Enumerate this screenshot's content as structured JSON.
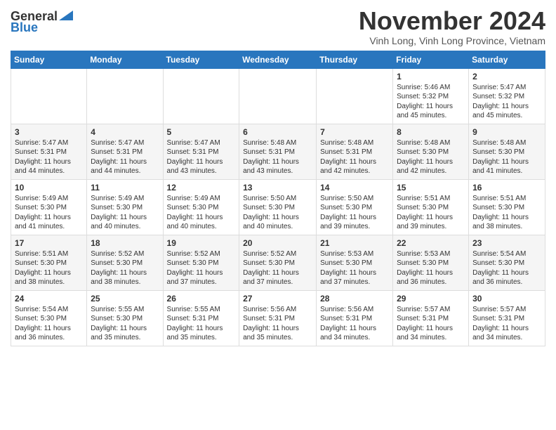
{
  "header": {
    "logo_general": "General",
    "logo_blue": "Blue",
    "month_title": "November 2024",
    "location": "Vinh Long, Vinh Long Province, Vietnam"
  },
  "days_of_week": [
    "Sunday",
    "Monday",
    "Tuesday",
    "Wednesday",
    "Thursday",
    "Friday",
    "Saturday"
  ],
  "weeks": [
    [
      {
        "day": "",
        "info": ""
      },
      {
        "day": "",
        "info": ""
      },
      {
        "day": "",
        "info": ""
      },
      {
        "day": "",
        "info": ""
      },
      {
        "day": "",
        "info": ""
      },
      {
        "day": "1",
        "info": "Sunrise: 5:46 AM\nSunset: 5:32 PM\nDaylight: 11 hours and 45 minutes."
      },
      {
        "day": "2",
        "info": "Sunrise: 5:47 AM\nSunset: 5:32 PM\nDaylight: 11 hours and 45 minutes."
      }
    ],
    [
      {
        "day": "3",
        "info": "Sunrise: 5:47 AM\nSunset: 5:31 PM\nDaylight: 11 hours and 44 minutes."
      },
      {
        "day": "4",
        "info": "Sunrise: 5:47 AM\nSunset: 5:31 PM\nDaylight: 11 hours and 44 minutes."
      },
      {
        "day": "5",
        "info": "Sunrise: 5:47 AM\nSunset: 5:31 PM\nDaylight: 11 hours and 43 minutes."
      },
      {
        "day": "6",
        "info": "Sunrise: 5:48 AM\nSunset: 5:31 PM\nDaylight: 11 hours and 43 minutes."
      },
      {
        "day": "7",
        "info": "Sunrise: 5:48 AM\nSunset: 5:31 PM\nDaylight: 11 hours and 42 minutes."
      },
      {
        "day": "8",
        "info": "Sunrise: 5:48 AM\nSunset: 5:30 PM\nDaylight: 11 hours and 42 minutes."
      },
      {
        "day": "9",
        "info": "Sunrise: 5:48 AM\nSunset: 5:30 PM\nDaylight: 11 hours and 41 minutes."
      }
    ],
    [
      {
        "day": "10",
        "info": "Sunrise: 5:49 AM\nSunset: 5:30 PM\nDaylight: 11 hours and 41 minutes."
      },
      {
        "day": "11",
        "info": "Sunrise: 5:49 AM\nSunset: 5:30 PM\nDaylight: 11 hours and 40 minutes."
      },
      {
        "day": "12",
        "info": "Sunrise: 5:49 AM\nSunset: 5:30 PM\nDaylight: 11 hours and 40 minutes."
      },
      {
        "day": "13",
        "info": "Sunrise: 5:50 AM\nSunset: 5:30 PM\nDaylight: 11 hours and 40 minutes."
      },
      {
        "day": "14",
        "info": "Sunrise: 5:50 AM\nSunset: 5:30 PM\nDaylight: 11 hours and 39 minutes."
      },
      {
        "day": "15",
        "info": "Sunrise: 5:51 AM\nSunset: 5:30 PM\nDaylight: 11 hours and 39 minutes."
      },
      {
        "day": "16",
        "info": "Sunrise: 5:51 AM\nSunset: 5:30 PM\nDaylight: 11 hours and 38 minutes."
      }
    ],
    [
      {
        "day": "17",
        "info": "Sunrise: 5:51 AM\nSunset: 5:30 PM\nDaylight: 11 hours and 38 minutes."
      },
      {
        "day": "18",
        "info": "Sunrise: 5:52 AM\nSunset: 5:30 PM\nDaylight: 11 hours and 38 minutes."
      },
      {
        "day": "19",
        "info": "Sunrise: 5:52 AM\nSunset: 5:30 PM\nDaylight: 11 hours and 37 minutes."
      },
      {
        "day": "20",
        "info": "Sunrise: 5:52 AM\nSunset: 5:30 PM\nDaylight: 11 hours and 37 minutes."
      },
      {
        "day": "21",
        "info": "Sunrise: 5:53 AM\nSunset: 5:30 PM\nDaylight: 11 hours and 37 minutes."
      },
      {
        "day": "22",
        "info": "Sunrise: 5:53 AM\nSunset: 5:30 PM\nDaylight: 11 hours and 36 minutes."
      },
      {
        "day": "23",
        "info": "Sunrise: 5:54 AM\nSunset: 5:30 PM\nDaylight: 11 hours and 36 minutes."
      }
    ],
    [
      {
        "day": "24",
        "info": "Sunrise: 5:54 AM\nSunset: 5:30 PM\nDaylight: 11 hours and 36 minutes."
      },
      {
        "day": "25",
        "info": "Sunrise: 5:55 AM\nSunset: 5:30 PM\nDaylight: 11 hours and 35 minutes."
      },
      {
        "day": "26",
        "info": "Sunrise: 5:55 AM\nSunset: 5:31 PM\nDaylight: 11 hours and 35 minutes."
      },
      {
        "day": "27",
        "info": "Sunrise: 5:56 AM\nSunset: 5:31 PM\nDaylight: 11 hours and 35 minutes."
      },
      {
        "day": "28",
        "info": "Sunrise: 5:56 AM\nSunset: 5:31 PM\nDaylight: 11 hours and 34 minutes."
      },
      {
        "day": "29",
        "info": "Sunrise: 5:57 AM\nSunset: 5:31 PM\nDaylight: 11 hours and 34 minutes."
      },
      {
        "day": "30",
        "info": "Sunrise: 5:57 AM\nSunset: 5:31 PM\nDaylight: 11 hours and 34 minutes."
      }
    ]
  ]
}
